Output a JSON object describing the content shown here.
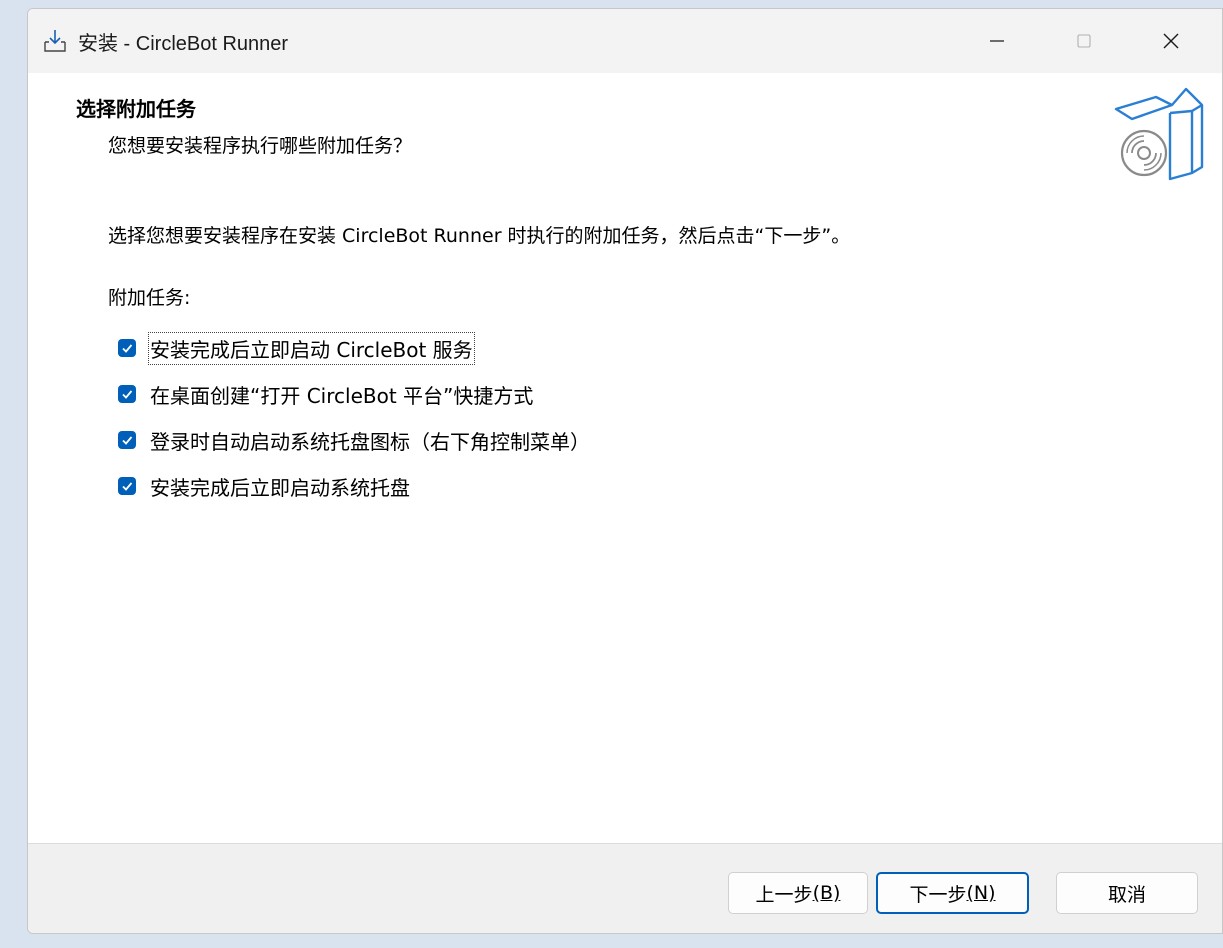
{
  "window": {
    "title": "安装 - CircleBot Runner",
    "controls": {
      "minimize_icon": "minimize-icon",
      "maximize_icon": "maximize-icon",
      "close_icon": "close-icon"
    }
  },
  "page": {
    "heading": "选择附加任务",
    "subheading": "您想要安装程序执行哪些附加任务？",
    "instruction": "选择您想要安装程序在安装 CircleBot Runner 时执行的附加任务，然后点击“下一步”。",
    "tasks_label": "附加任务:",
    "tasks": [
      {
        "label": "安装完成后立即启动 CircleBot 服务",
        "checked": true
      },
      {
        "label": "在桌面创建“打开 CircleBot 平台”快捷方式",
        "checked": true
      },
      {
        "label": "登录时自动启动系统托盘图标（右下角控制菜单）",
        "checked": true
      },
      {
        "label": "安装完成后立即启动系统托盘",
        "checked": true
      }
    ]
  },
  "footer": {
    "back_label": "上一步",
    "back_accel": "(B)",
    "next_label": "下一步",
    "next_accel": "(N)",
    "cancel_label": "取消"
  },
  "colors": {
    "accent": "#005fb8",
    "box_icon": "#2a7fd4"
  }
}
